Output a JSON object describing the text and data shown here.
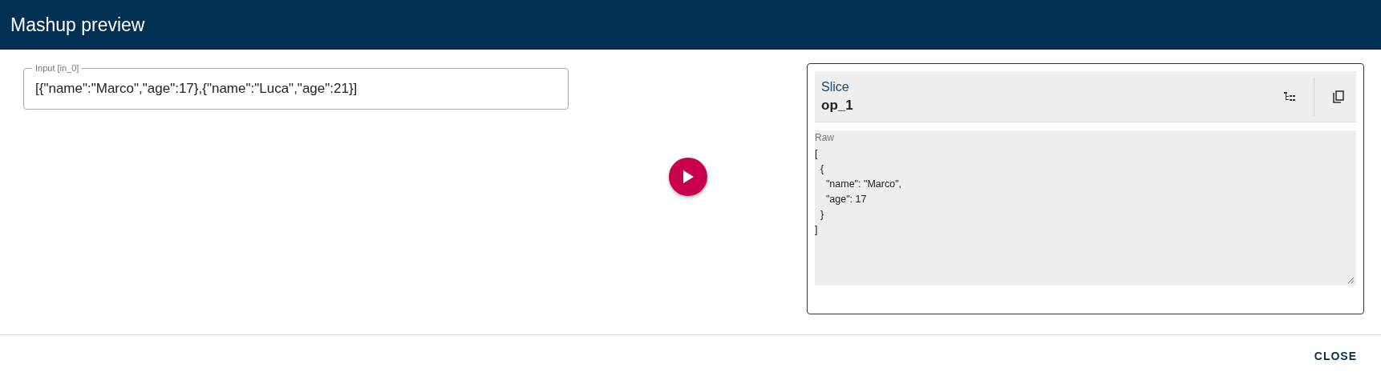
{
  "window": {
    "title": "Mashup preview"
  },
  "input": {
    "label": "Input [in_0]",
    "value": "[{\"name\":\"Marco\",\"age\":17},{\"name\":\"Luca\",\"age\":21}]"
  },
  "output": {
    "operator": "Slice",
    "name": "op_1",
    "raw_label": "Raw",
    "raw_lines": [
      "[",
      "  {",
      "    \"name\": \"Marco\",",
      "    \"age\": 17",
      "  }",
      "]"
    ]
  },
  "buttons": [
    "CLOSE"
  ]
}
